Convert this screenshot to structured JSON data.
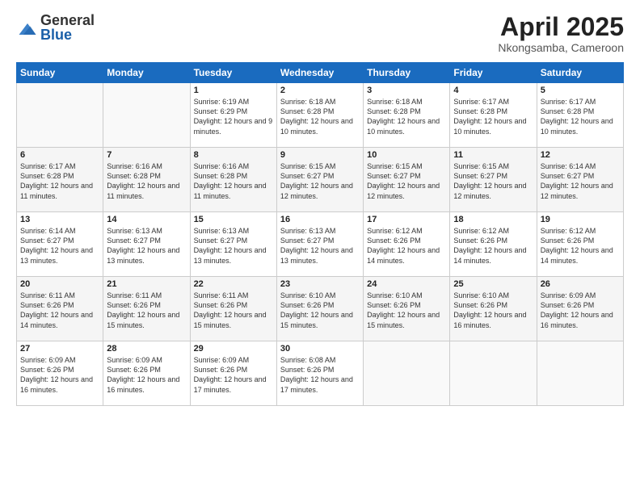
{
  "header": {
    "logo_general": "General",
    "logo_blue": "Blue",
    "month_title": "April 2025",
    "location": "Nkongsamba, Cameroon"
  },
  "weekdays": [
    "Sunday",
    "Monday",
    "Tuesday",
    "Wednesday",
    "Thursday",
    "Friday",
    "Saturday"
  ],
  "weeks": [
    [
      {
        "day": "",
        "info": ""
      },
      {
        "day": "",
        "info": ""
      },
      {
        "day": "1",
        "info": "Sunrise: 6:19 AM\nSunset: 6:29 PM\nDaylight: 12 hours and 9 minutes."
      },
      {
        "day": "2",
        "info": "Sunrise: 6:18 AM\nSunset: 6:28 PM\nDaylight: 12 hours and 10 minutes."
      },
      {
        "day": "3",
        "info": "Sunrise: 6:18 AM\nSunset: 6:28 PM\nDaylight: 12 hours and 10 minutes."
      },
      {
        "day": "4",
        "info": "Sunrise: 6:17 AM\nSunset: 6:28 PM\nDaylight: 12 hours and 10 minutes."
      },
      {
        "day": "5",
        "info": "Sunrise: 6:17 AM\nSunset: 6:28 PM\nDaylight: 12 hours and 10 minutes."
      }
    ],
    [
      {
        "day": "6",
        "info": "Sunrise: 6:17 AM\nSunset: 6:28 PM\nDaylight: 12 hours and 11 minutes."
      },
      {
        "day": "7",
        "info": "Sunrise: 6:16 AM\nSunset: 6:28 PM\nDaylight: 12 hours and 11 minutes."
      },
      {
        "day": "8",
        "info": "Sunrise: 6:16 AM\nSunset: 6:28 PM\nDaylight: 12 hours and 11 minutes."
      },
      {
        "day": "9",
        "info": "Sunrise: 6:15 AM\nSunset: 6:27 PM\nDaylight: 12 hours and 12 minutes."
      },
      {
        "day": "10",
        "info": "Sunrise: 6:15 AM\nSunset: 6:27 PM\nDaylight: 12 hours and 12 minutes."
      },
      {
        "day": "11",
        "info": "Sunrise: 6:15 AM\nSunset: 6:27 PM\nDaylight: 12 hours and 12 minutes."
      },
      {
        "day": "12",
        "info": "Sunrise: 6:14 AM\nSunset: 6:27 PM\nDaylight: 12 hours and 12 minutes."
      }
    ],
    [
      {
        "day": "13",
        "info": "Sunrise: 6:14 AM\nSunset: 6:27 PM\nDaylight: 12 hours and 13 minutes."
      },
      {
        "day": "14",
        "info": "Sunrise: 6:13 AM\nSunset: 6:27 PM\nDaylight: 12 hours and 13 minutes."
      },
      {
        "day": "15",
        "info": "Sunrise: 6:13 AM\nSunset: 6:27 PM\nDaylight: 12 hours and 13 minutes."
      },
      {
        "day": "16",
        "info": "Sunrise: 6:13 AM\nSunset: 6:27 PM\nDaylight: 12 hours and 13 minutes."
      },
      {
        "day": "17",
        "info": "Sunrise: 6:12 AM\nSunset: 6:26 PM\nDaylight: 12 hours and 14 minutes."
      },
      {
        "day": "18",
        "info": "Sunrise: 6:12 AM\nSunset: 6:26 PM\nDaylight: 12 hours and 14 minutes."
      },
      {
        "day": "19",
        "info": "Sunrise: 6:12 AM\nSunset: 6:26 PM\nDaylight: 12 hours and 14 minutes."
      }
    ],
    [
      {
        "day": "20",
        "info": "Sunrise: 6:11 AM\nSunset: 6:26 PM\nDaylight: 12 hours and 14 minutes."
      },
      {
        "day": "21",
        "info": "Sunrise: 6:11 AM\nSunset: 6:26 PM\nDaylight: 12 hours and 15 minutes."
      },
      {
        "day": "22",
        "info": "Sunrise: 6:11 AM\nSunset: 6:26 PM\nDaylight: 12 hours and 15 minutes."
      },
      {
        "day": "23",
        "info": "Sunrise: 6:10 AM\nSunset: 6:26 PM\nDaylight: 12 hours and 15 minutes."
      },
      {
        "day": "24",
        "info": "Sunrise: 6:10 AM\nSunset: 6:26 PM\nDaylight: 12 hours and 15 minutes."
      },
      {
        "day": "25",
        "info": "Sunrise: 6:10 AM\nSunset: 6:26 PM\nDaylight: 12 hours and 16 minutes."
      },
      {
        "day": "26",
        "info": "Sunrise: 6:09 AM\nSunset: 6:26 PM\nDaylight: 12 hours and 16 minutes."
      }
    ],
    [
      {
        "day": "27",
        "info": "Sunrise: 6:09 AM\nSunset: 6:26 PM\nDaylight: 12 hours and 16 minutes."
      },
      {
        "day": "28",
        "info": "Sunrise: 6:09 AM\nSunset: 6:26 PM\nDaylight: 12 hours and 16 minutes."
      },
      {
        "day": "29",
        "info": "Sunrise: 6:09 AM\nSunset: 6:26 PM\nDaylight: 12 hours and 17 minutes."
      },
      {
        "day": "30",
        "info": "Sunrise: 6:08 AM\nSunset: 6:26 PM\nDaylight: 12 hours and 17 minutes."
      },
      {
        "day": "",
        "info": ""
      },
      {
        "day": "",
        "info": ""
      },
      {
        "day": "",
        "info": ""
      }
    ]
  ]
}
